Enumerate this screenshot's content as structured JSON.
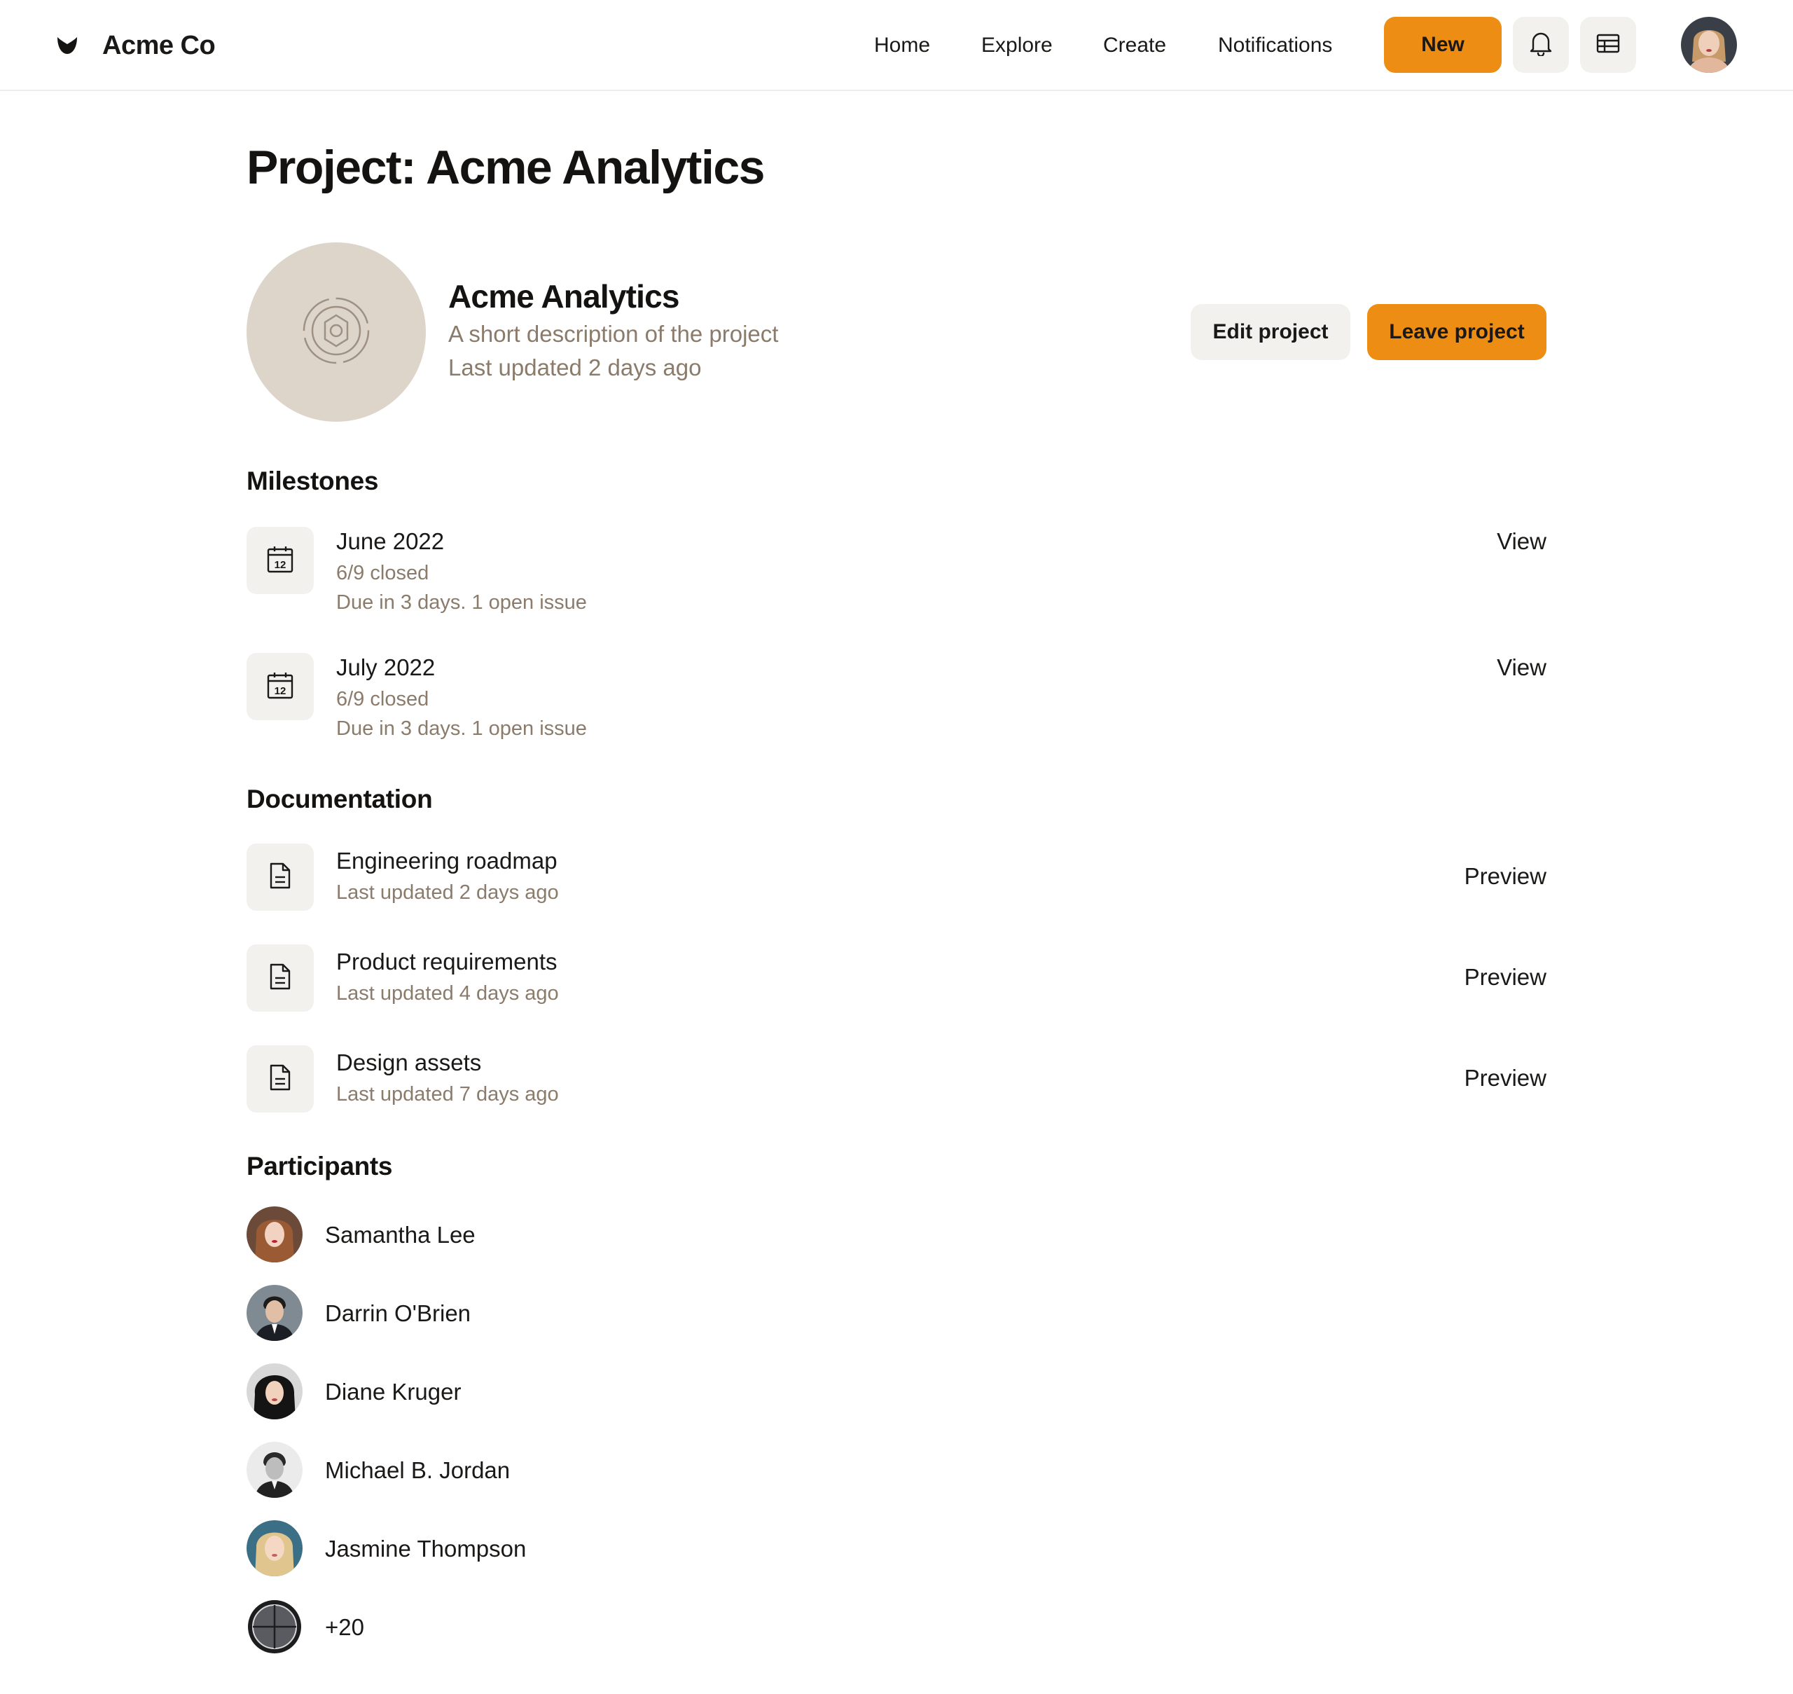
{
  "brand": {
    "name": "Acme Co",
    "logo_icon": "paw-leaf-icon"
  },
  "nav": {
    "links": [
      "Home",
      "Explore",
      "Create",
      "Notifications"
    ]
  },
  "header_actions": {
    "new_label": "New",
    "bell_icon": "bell-icon",
    "table_icon": "table-icon"
  },
  "page": {
    "title": "Project: Acme Analytics"
  },
  "project": {
    "name": "Acme Analytics",
    "description": "A short description of the project",
    "updated": "Last updated 2 days ago",
    "edit_label": "Edit project",
    "leave_label": "Leave project"
  },
  "milestones": {
    "title": "Milestones",
    "items": [
      {
        "title": "June 2022",
        "closed": "6/9 closed",
        "due": "Due in 3 days. 1 open issue",
        "action": "View"
      },
      {
        "title": "July 2022",
        "closed": "6/9 closed",
        "due": "Due in 3 days. 1 open issue",
        "action": "View"
      }
    ]
  },
  "documentation": {
    "title": "Documentation",
    "items": [
      {
        "title": "Engineering roadmap",
        "updated": "Last updated 2 days ago",
        "action": "Preview"
      },
      {
        "title": "Product requirements",
        "updated": "Last updated 4 days ago",
        "action": "Preview"
      },
      {
        "title": "Design assets",
        "updated": "Last updated 7 days ago",
        "action": "Preview"
      }
    ]
  },
  "participants": {
    "title": "Participants",
    "people": [
      "Samantha Lee",
      "Darrin O'Brien",
      "Diane Kruger",
      "Michael B. Jordan",
      "Jasmine Thompson"
    ],
    "more": "+20"
  },
  "colors": {
    "accent": "#ee8d14",
    "muted_text": "#8b7b6b",
    "tile_bg": "#f3f1ee",
    "logo_bg": "#ddd4ca"
  }
}
